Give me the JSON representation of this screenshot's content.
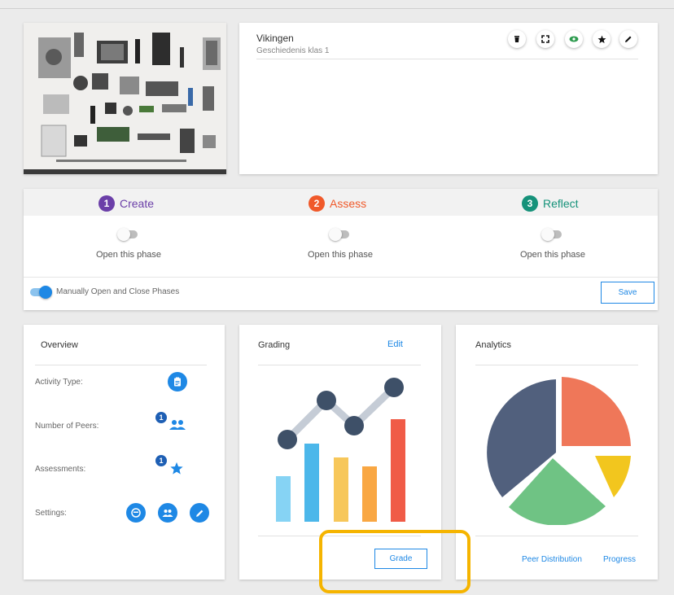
{
  "activity": {
    "title": "Vikingen",
    "subtitle": "Geschiedenis klas 1",
    "toolbar_icons": [
      "trash-icon",
      "fullscreen-icon",
      "eye-icon",
      "star-icon",
      "pencil-icon"
    ]
  },
  "phases": [
    {
      "number": "1",
      "name": "Create",
      "color": "#6b3fa8",
      "toggle_label": "Open this phase"
    },
    {
      "number": "2",
      "name": "Assess",
      "color": "#f0592a",
      "toggle_label": "Open this phase"
    },
    {
      "number": "3",
      "name": "Reflect",
      "color": "#16927a",
      "toggle_label": "Open this phase"
    }
  ],
  "manual": {
    "label": "Manually Open and Close Phases",
    "save_label": "Save"
  },
  "overview": {
    "title": "Overview",
    "rows": [
      {
        "label": "Activity Type:"
      },
      {
        "label": "Number of Peers:",
        "badge": "1"
      },
      {
        "label": "Assessments:",
        "badge": "1"
      },
      {
        "label": "Settings:"
      }
    ]
  },
  "grading": {
    "title": "Grading",
    "edit_label": "Edit",
    "grade_label": "Grade"
  },
  "analytics": {
    "title": "Analytics",
    "peer_distribution_label": "Peer Distribution",
    "progress_label": "Progress"
  },
  "colors": {
    "accent": "#1e88e5",
    "highlight": "#f5b400"
  }
}
